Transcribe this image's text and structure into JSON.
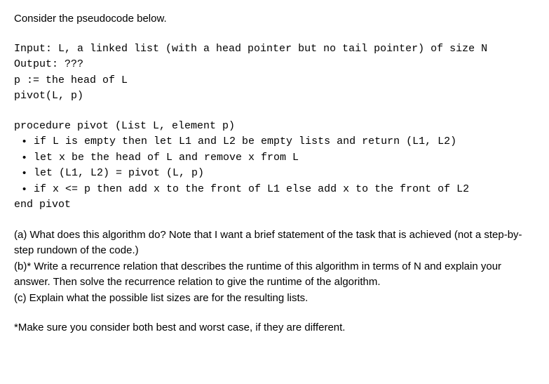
{
  "intro": "Consider the pseudocode below.",
  "code": {
    "line1": "Input: L, a linked list (with a head pointer but no tail pointer) of size N",
    "line2": "Output: ???",
    "line3": "p := the head of L",
    "line4": "pivot(L, p)"
  },
  "procedure": {
    "header": "procedure pivot (List L, element p)",
    "bullets": [
      "if L is empty then let L1 and L2 be empty lists and return (L1, L2)",
      "let x be the head of L and remove x from L",
      "let (L1, L2) = pivot (L, p)",
      "if x <= p then add x to the front of L1 else add x to the front of L2"
    ],
    "footer": "end pivot"
  },
  "questions": {
    "a": "(a) What does this algorithm do? Note that I want a brief statement of the task that is achieved (not a step-by-step rundown of the code.)",
    "b": "(b)* Write a recurrence relation that describes the runtime of this algorithm in terms of N and explain your answer. Then solve the recurrence relation to give the runtime of the algorithm.",
    "c": "(c) Explain what the possible list sizes are for the resulting lists."
  },
  "footnote": "*Make sure you consider both best and worst case, if they are different."
}
